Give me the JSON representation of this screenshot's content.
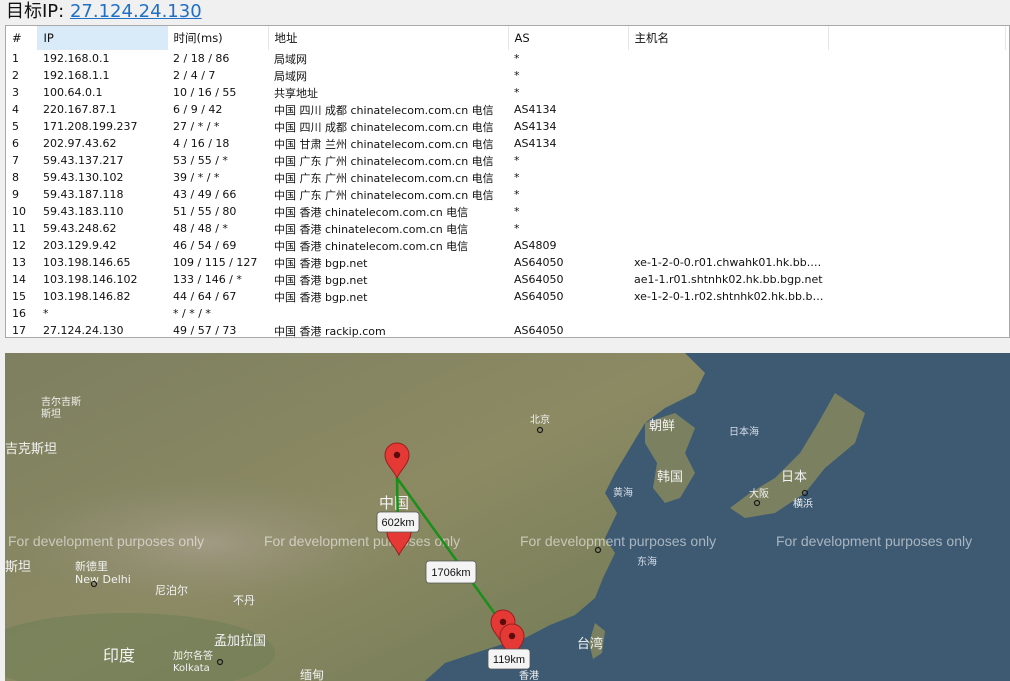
{
  "header": {
    "label": "目标IP:",
    "target_ip": "27.124.24.130"
  },
  "table": {
    "columns": [
      "#",
      "IP",
      "时间(ms)",
      "地址",
      "AS",
      "主机名"
    ],
    "rows": [
      [
        "1",
        "192.168.0.1",
        "2 / 18 / 86",
        "局域网",
        "*",
        ""
      ],
      [
        "2",
        "192.168.1.1",
        "2 / 4 / 7",
        "局域网",
        "*",
        ""
      ],
      [
        "3",
        "100.64.0.1",
        "10 / 16 / 55",
        "共享地址",
        "*",
        ""
      ],
      [
        "4",
        "220.167.87.1",
        "6 / 9 / 42",
        "中国 四川 成都 chinatelecom.com.cn 电信",
        "AS4134",
        ""
      ],
      [
        "5",
        "171.208.199.237",
        "27 / * / *",
        "中国 四川 成都 chinatelecom.com.cn 电信",
        "AS4134",
        ""
      ],
      [
        "6",
        "202.97.43.62",
        "4 / 16 / 18",
        "中国 甘肃 兰州 chinatelecom.com.cn 电信",
        "AS4134",
        ""
      ],
      [
        "7",
        "59.43.137.217",
        "53 / 55 / *",
        "中国 广东 广州 chinatelecom.com.cn 电信",
        "*",
        ""
      ],
      [
        "8",
        "59.43.130.102",
        "39 / * / *",
        "中国 广东 广州 chinatelecom.com.cn 电信",
        "*",
        ""
      ],
      [
        "9",
        "59.43.187.118",
        "43 / 49 / 66",
        "中国 广东 广州 chinatelecom.com.cn 电信",
        "*",
        ""
      ],
      [
        "10",
        "59.43.183.110",
        "51 / 55 / 80",
        "中国 香港 chinatelecom.com.cn 电信",
        "*",
        ""
      ],
      [
        "11",
        "59.43.248.62",
        "48 / 48 / *",
        "中国 香港 chinatelecom.com.cn 电信",
        "*",
        ""
      ],
      [
        "12",
        "203.129.9.42",
        "46 / 54 / 69",
        "中国 香港 chinatelecom.com.cn 电信",
        "AS4809",
        ""
      ],
      [
        "13",
        "103.198.146.65",
        "109 / 115 / 127",
        "中国 香港 bgp.net",
        "AS64050",
        "xe-1-2-0-0.r01.chwahk01.hk.bb.bg..."
      ],
      [
        "14",
        "103.198.146.102",
        "133 / 146 / *",
        "中国 香港 bgp.net",
        "AS64050",
        "ae1-1.r01.shtnhk02.hk.bb.bgp.net"
      ],
      [
        "15",
        "103.198.146.82",
        "44 / 64 / 67",
        "中国 香港 bgp.net",
        "AS64050",
        "xe-1-2-0-1.r02.shtnhk02.hk.bb.bgp..."
      ],
      [
        "16",
        "*",
        "* / * / *",
        "",
        "",
        ""
      ],
      [
        "17",
        "27.124.24.130",
        "49 / 57 / 73",
        "中国 香港 rackip.com",
        "AS64050",
        ""
      ]
    ]
  },
  "map": {
    "watermark": "For development purposes only",
    "places": [
      {
        "id": "jierjisi",
        "text": "吉尔吉斯\n斯坦"
      },
      {
        "id": "jikesitan",
        "text": "吉克斯坦"
      },
      {
        "id": "beijing",
        "text": "北京"
      },
      {
        "id": "chaoxian",
        "text": "朝鲜"
      },
      {
        "id": "ribenhai",
        "text": "日本海"
      },
      {
        "id": "hanguo",
        "text": "韩国"
      },
      {
        "id": "riben",
        "text": "日本"
      },
      {
        "id": "daban",
        "text": "大阪"
      },
      {
        "id": "hengbin",
        "text": "横浜"
      },
      {
        "id": "huanghai",
        "text": "黄海"
      },
      {
        "id": "zhongguo",
        "text": "中国"
      },
      {
        "id": "donghai",
        "text": "东海"
      },
      {
        "id": "sitan",
        "text": "斯坦"
      },
      {
        "id": "xindeli",
        "text": "新德里\nNew Delhi"
      },
      {
        "id": "niboer",
        "text": "尼泊尔"
      },
      {
        "id": "budan",
        "text": "不丹"
      },
      {
        "id": "mengjiala",
        "text": "孟加拉国"
      },
      {
        "id": "yindu",
        "text": "印度"
      },
      {
        "id": "jiaerge",
        "text": "加尔各答\nKolkata"
      },
      {
        "id": "miandian",
        "text": "缅甸"
      },
      {
        "id": "taiwan",
        "text": "台湾"
      },
      {
        "id": "xianggang",
        "text": "香港"
      }
    ],
    "distances": [
      "602km",
      "1706km",
      "119km"
    ],
    "colors": {
      "route": "#1a8f1a",
      "marker": "#e53935",
      "land": "#8a8a62",
      "sea": "#3c5a73"
    }
  }
}
